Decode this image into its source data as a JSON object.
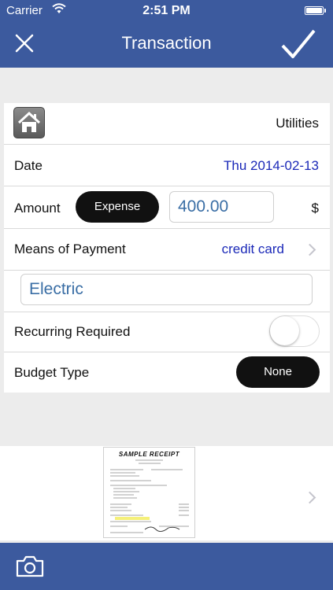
{
  "status_bar": {
    "carrier": "Carrier",
    "time": "2:51 PM"
  },
  "nav": {
    "title": "Transaction"
  },
  "form": {
    "category": "Utilities",
    "date_label": "Date",
    "date_value": "Thu 2014-02-13",
    "amount_label": "Amount",
    "amount_type": "Expense",
    "amount_value": "400.00",
    "currency": "$",
    "payment_label": "Means of Payment",
    "payment_value": "credit card",
    "note_value": "Electric",
    "recurring_label": "Recurring Required",
    "recurring_on": false,
    "budget_label": "Budget Type",
    "budget_value": "None"
  },
  "receipt": {
    "title": "SAMPLE RECEIPT"
  },
  "colors": {
    "header_bg": "#3c5a9e",
    "link_blue": "#1b29b8",
    "field_text": "#3a6ea5"
  },
  "icons": [
    "close-icon",
    "checkmark-icon",
    "house-icon",
    "chevron-right-icon",
    "camera-icon",
    "wifi-icon",
    "battery-icon"
  ]
}
